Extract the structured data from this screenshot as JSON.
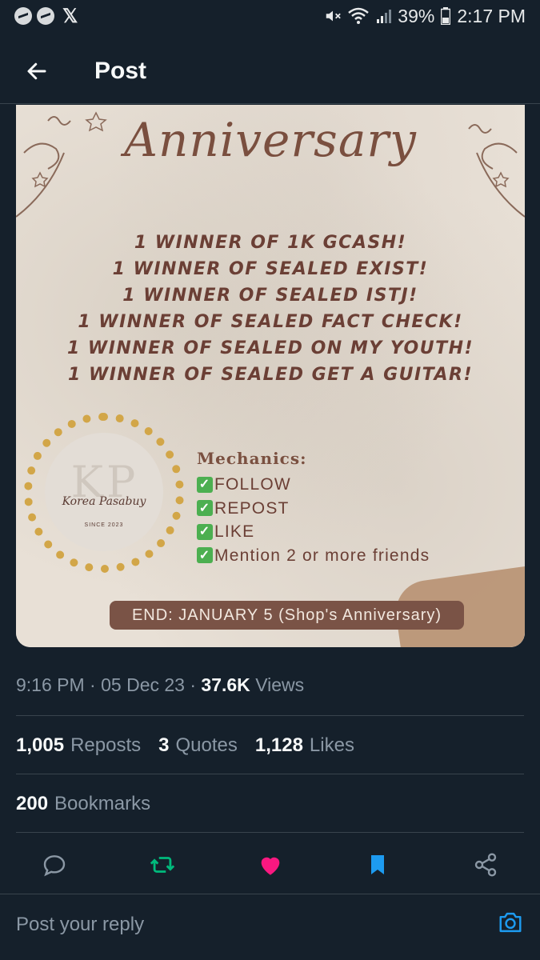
{
  "status_bar": {
    "battery": "39%",
    "time": "2:17 PM",
    "app_icons": [
      "messenger-icon",
      "messenger-icon",
      "x-logo"
    ]
  },
  "header": {
    "title": "Post"
  },
  "post_image": {
    "title": "Anniversary",
    "winners": [
      "1 WINNER OF 1K GCASH!",
      "1 WINNER OF SEALED EXIST!",
      "1 WINNER OF SEALED ISTJ!",
      "1 WINNER OF SEALED FACT CHECK!",
      "1 WINNER OF SEALED ON MY YOUTH!",
      "1 WINNER OF SEALED GET A GUITAR!"
    ],
    "mechanics_title": "Mechanics:",
    "mechanics": [
      "FOLLOW",
      "REPOST",
      "LIKE",
      "Mention 2 or more friends"
    ],
    "end_text": "END: JANUARY 5 (Shop's Anniversary)",
    "brand_letters": "KP",
    "brand_name": "Korea Pasabuy",
    "brand_since": "SINCE 2023"
  },
  "meta": {
    "time": "9:16 PM",
    "date": "05 Dec 23",
    "views_count": "37.6K",
    "views_label": "Views"
  },
  "stats": {
    "reposts_count": "1,005",
    "reposts_label": "Reposts",
    "quotes_count": "3",
    "quotes_label": "Quotes",
    "likes_count": "1,128",
    "likes_label": "Likes",
    "bookmarks_count": "200",
    "bookmarks_label": "Bookmarks"
  },
  "actions": {
    "reply_icon": "reply-icon",
    "repost_icon": "repost-icon",
    "like_icon": "heart-icon",
    "bookmark_icon": "bookmark-icon",
    "share_icon": "share-icon"
  },
  "reply": {
    "placeholder": "Post your reply"
  },
  "colors": {
    "background": "#15202b",
    "accent": "#1d9bf0",
    "repost_active": "#00ba7c",
    "like_active": "#f91880",
    "bookmark_active": "#1d9bf0"
  }
}
